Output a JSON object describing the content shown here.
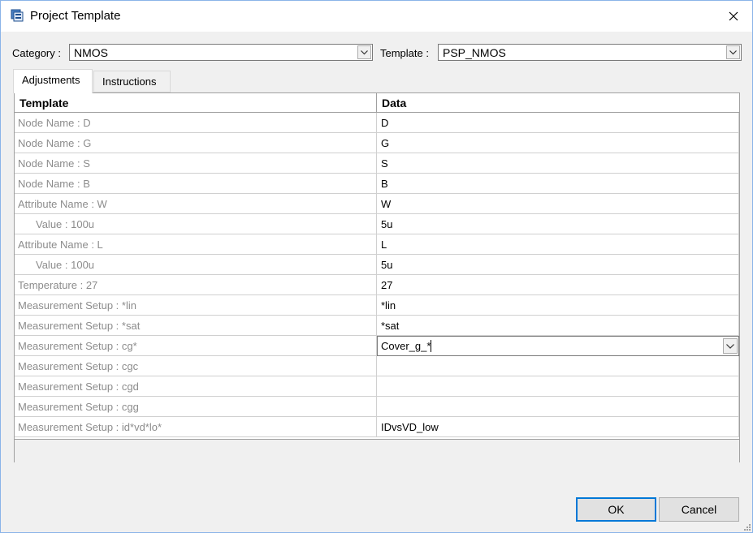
{
  "window": {
    "title": "Project Template"
  },
  "category": {
    "label": "Category :",
    "value": "NMOS"
  },
  "template": {
    "label": "Template :",
    "value": "PSP_NMOS"
  },
  "tabs": [
    {
      "label": "Adjustments",
      "active": true
    },
    {
      "label": "Instructions",
      "active": false
    }
  ],
  "grid": {
    "headers": [
      "Template",
      "Data"
    ],
    "rows": [
      {
        "template": "Node Name : D",
        "data": "D"
      },
      {
        "template": "Node Name : G",
        "data": "G"
      },
      {
        "template": "Node Name : S",
        "data": "S"
      },
      {
        "template": "Node Name : B",
        "data": "B"
      },
      {
        "template": "Attribute Name : W",
        "data": "W"
      },
      {
        "template": "Value : 100u",
        "data": "5u",
        "indent": true
      },
      {
        "template": "Attribute Name : L",
        "data": "L"
      },
      {
        "template": "Value : 100u",
        "data": "5u",
        "indent": true
      },
      {
        "template": "Temperature : 27",
        "data": "27"
      },
      {
        "template": "Measurement Setup : *lin",
        "data": "*lin"
      },
      {
        "template": "Measurement Setup : *sat",
        "data": "*sat"
      },
      {
        "template": "Measurement Setup : cg*",
        "data": "Cover_g_*",
        "editing": true
      },
      {
        "template": "Measurement Setup : cgc",
        "data": ""
      },
      {
        "template": "Measurement Setup : cgd",
        "data": ""
      },
      {
        "template": "Measurement Setup : cgg",
        "data": ""
      },
      {
        "template": "Measurement Setup : id*vd*lo*",
        "data": "IDvsVD_low"
      }
    ]
  },
  "buttons": {
    "ok": "OK",
    "cancel": "Cancel"
  },
  "icons": {
    "app": "project-template-icon",
    "close": "close-icon",
    "dropdown": "chevron-down-icon"
  },
  "colors": {
    "accent": "#0078d7"
  }
}
